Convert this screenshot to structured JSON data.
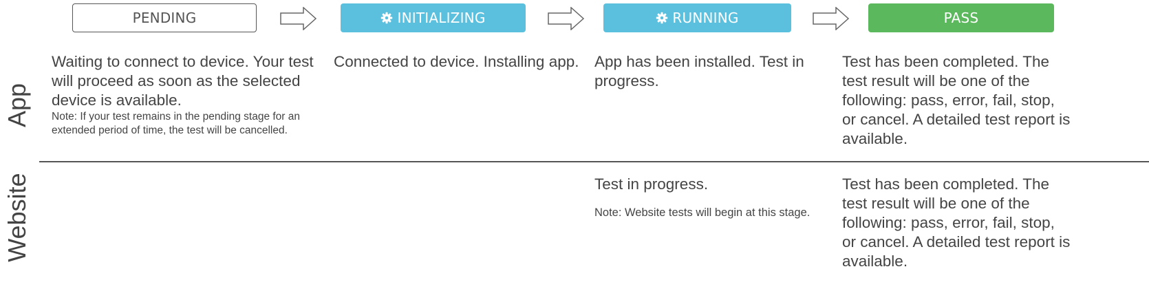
{
  "stages": [
    {
      "id": "pending",
      "label": "PENDING",
      "icon": "",
      "color": "#ffffff"
    },
    {
      "id": "initializing",
      "label": "INITIALIZING",
      "icon": "gear-icon",
      "color": "#5bc0de"
    },
    {
      "id": "running",
      "label": "RUNNING",
      "icon": "gear-icon",
      "color": "#5bc0de"
    },
    {
      "id": "pass",
      "label": "PASS",
      "icon": "",
      "color": "#5cb85c"
    }
  ],
  "rows": {
    "app": {
      "label": "App",
      "pending": {
        "text": "Waiting to connect to device. Your test will proceed as soon as the selected device is available.",
        "note": "Note: If your test remains in the pending stage for an extended period of time, the test will be cancelled."
      },
      "initializing": {
        "text": "Connected to device. Installing app."
      },
      "running": {
        "text": "App has been installed. Test in progress."
      },
      "pass": {
        "text": "Test has been completed. The test result will be one of the following: pass, error, fail, stop, or cancel. A detailed test report is available."
      }
    },
    "website": {
      "label": "Website",
      "running": {
        "text": "Test in progress.",
        "note": "Note: Website tests will begin at this stage."
      },
      "pass": {
        "text": "Test has been completed. The test result will be one of the following: pass, error, fail, stop, or cancel. A detailed test report is available."
      }
    }
  }
}
